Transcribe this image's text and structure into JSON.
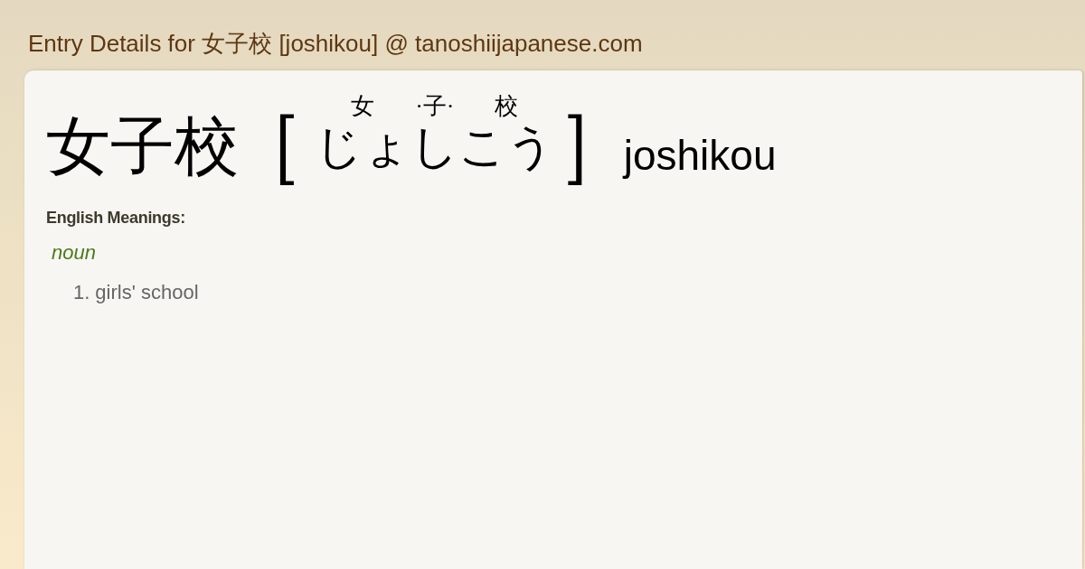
{
  "page_title": "Entry Details for 女子校 [joshikou] @ tanoshiijapanese.com",
  "entry": {
    "headword": "女子校",
    "bracket_open": "[",
    "reading": [
      {
        "ruby": "女",
        "kana": "じょ"
      },
      {
        "ruby": "·子·",
        "kana": "し"
      },
      {
        "ruby": "校",
        "kana": "こう"
      }
    ],
    "bracket_close": "]",
    "romaji": "joshikou"
  },
  "meanings": {
    "heading": "English Meanings:",
    "groups": [
      {
        "part_of_speech": "noun",
        "senses": [
          {
            "number": "1.",
            "text": "girls' school"
          }
        ]
      }
    ]
  }
}
